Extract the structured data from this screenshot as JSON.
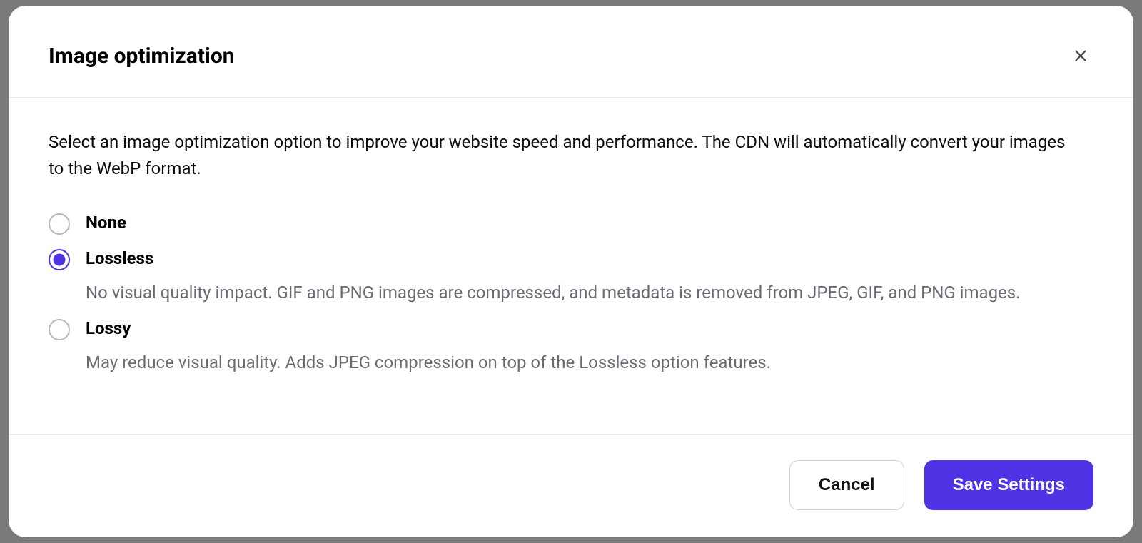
{
  "modal": {
    "title": "Image optimization",
    "description": "Select an image optimization option to improve your website speed and performance. The CDN will automatically convert your images to the WebP format.",
    "options": [
      {
        "id": "none",
        "label": "None",
        "description": "",
        "selected": false
      },
      {
        "id": "lossless",
        "label": "Lossless",
        "description": "No visual quality impact. GIF and PNG images are compressed, and metadata is removed from JPEG, GIF, and PNG images.",
        "selected": true
      },
      {
        "id": "lossy",
        "label": "Lossy",
        "description": "May reduce visual quality. Adds JPEG compression on top of the Lossless option features.",
        "selected": false
      }
    ],
    "footer": {
      "cancel_label": "Cancel",
      "save_label": "Save Settings"
    }
  },
  "colors": {
    "accent": "#4f33e5",
    "text_primary": "#000000",
    "text_secondary": "#6b6b75",
    "border": "#ececec"
  }
}
